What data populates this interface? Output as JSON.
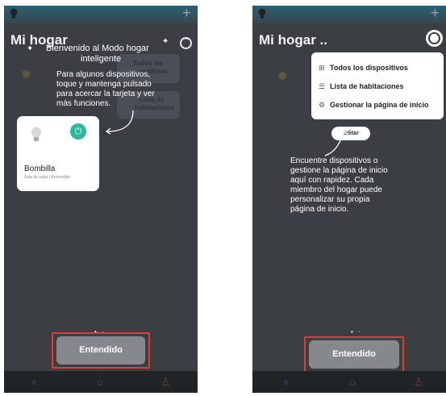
{
  "left": {
    "header_title": "Mi hogar",
    "faded_link1": "Todos los",
    "faded_link1b": "positivos",
    "faded_link2": "Lista de",
    "faded_link2b": "habitaciones",
    "tip_title_line1": "Bienvenido al Modo hogar",
    "tip_title_line2": "inteligente",
    "tip_body": [
      "Para algunos dispositivos,",
      "toque y mantenga pulsado",
      "para acercar la tarjeta y ver",
      "más funciones."
    ],
    "faded_edit": "Ed",
    "device": {
      "name": "Bombilla",
      "status": "Sala de estar | Encendido"
    },
    "button": "Entendido"
  },
  "right": {
    "header_title": "Mi hogar ..",
    "menu": [
      {
        "icon": "grid-icon",
        "label": "Todos los dispositivos"
      },
      {
        "icon": "list-icon",
        "label": "Lista de habitaciones"
      },
      {
        "icon": "gear-icon",
        "label": "Gestionar la página de inicio"
      }
    ],
    "edit_label": "Editar",
    "tip_body": [
      "Encuentre dispositivos o",
      "gestione la página de inicio",
      "aquí con rapidez. Cada",
      "miembro del hogar puede",
      "personalizar su propia",
      "página de inicio."
    ],
    "button": "Entendido"
  },
  "colors": {
    "highlight": "#e53935",
    "accent": "#2db89b"
  }
}
